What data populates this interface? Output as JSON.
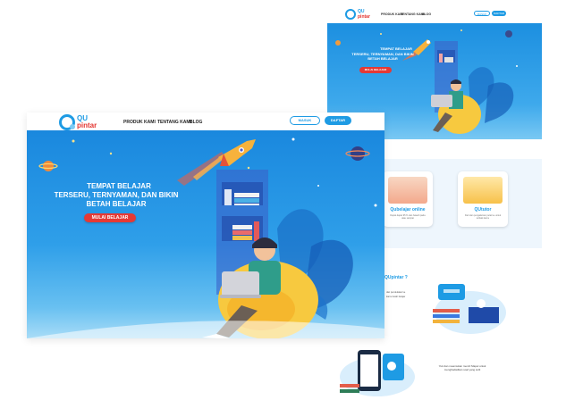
{
  "main": {
    "logo": {
      "qu": "QU",
      "pintar": "pintar"
    },
    "nav": [
      "PRODUK KAMI",
      "TENTANG KAMI",
      "BLOG"
    ],
    "login_label": "MASUK",
    "register_label": "DAFTAR",
    "hero": {
      "tagline": "TEMPAT BELAJAR",
      "headline_1": "TERSERU, TERNYAMAN, DAN BIKIN",
      "headline_2": "BETAH BELAJAR",
      "cta_label": "MULAI BELAJAR"
    }
  },
  "preview": {
    "logo": {
      "qu": "QU",
      "pintar": "pintar"
    },
    "nav": [
      "PRODUK KAMI",
      "TENTANG KAMI",
      "BLOG"
    ],
    "login_label": "MASUK",
    "register_label": "DAFTAR",
    "hero": {
      "tagline": "TEMPAT BELAJAR",
      "headline_1": "TERSERU, TERNYAMAN, DAN BIKIN",
      "headline_2": "BETAH BELAJAR",
      "cta_label": "MULAI BELAJAR"
    },
    "products": [
      {
        "title": "Qubelajar online",
        "desc": "Dapat dapat 95 % dan bawah pada atau sampai"
      },
      {
        "title": "QUtutor",
        "desc": "Dari dan pengalaman pelat ke untuk terbaik kamu"
      }
    ],
    "about_title": "QUpintar ?",
    "about_lines": [
      "dan pendekatan ke",
      "kamu betah belajar"
    ],
    "feature_text": "Yuk dan meamukan mentri Mapel untuk menghadadkan soal yang sulit"
  },
  "colors": {
    "brand_blue": "#1e9be4",
    "brand_red": "#e3342f",
    "cta_red": "#e53935"
  }
}
